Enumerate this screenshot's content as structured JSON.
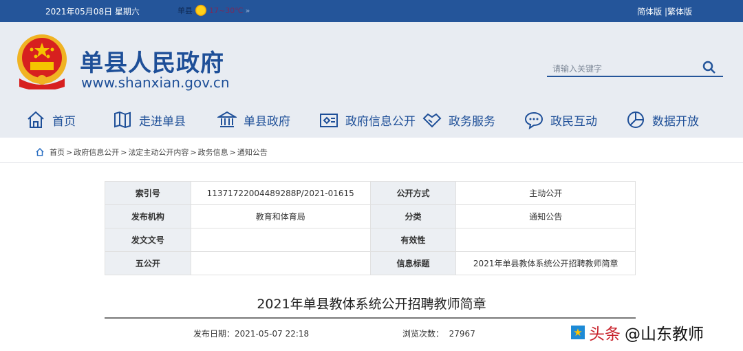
{
  "topbar": {
    "date": "2021年05月08日 星期六",
    "weather_city": "单县",
    "weather_temp": "17~30℃",
    "weather_more": "»",
    "lang_simplified": "简体版",
    "lang_sep": "|",
    "lang_traditional": "繁体版"
  },
  "header": {
    "site_name": "单县人民政府",
    "url": "www.shanxian.gov.cn",
    "search_placeholder": "请输入关键字"
  },
  "nav": [
    {
      "label": "首页",
      "icon": "home-icon"
    },
    {
      "label": "走进单县",
      "icon": "map-icon"
    },
    {
      "label": "单县政府",
      "icon": "building-icon"
    },
    {
      "label": "政府信息公开",
      "icon": "document-icon"
    },
    {
      "label": "政务服务",
      "icon": "handshake-icon"
    },
    {
      "label": "政民互动",
      "icon": "chat-icon"
    },
    {
      "label": "数据开放",
      "icon": "data-icon"
    }
  ],
  "breadcrumb": [
    "首页",
    "政府信息公开",
    "法定主动公开内容",
    "政务信息",
    "通知公告"
  ],
  "breadcrumb_sep": ">",
  "info_table": [
    [
      "索引号",
      "11371722004489288P/2021-01615",
      "公开方式",
      "主动公开"
    ],
    [
      "发布机构",
      "教育和体育局",
      "分类",
      "通知公告"
    ],
    [
      "发文文号",
      "",
      "有效性",
      ""
    ],
    [
      "五公开",
      "",
      "信息标题",
      "2021年单县教体系统公开招聘教师简章"
    ]
  ],
  "article": {
    "title": "2021年单县教体系统公开招聘教师简章",
    "publish_label": "发布日期：",
    "publish_date": "2021-05-07 22:18",
    "views_label": "浏览次数：",
    "views": "27967"
  },
  "watermark": {
    "platform": "头条",
    "account": "@山东教师"
  }
}
